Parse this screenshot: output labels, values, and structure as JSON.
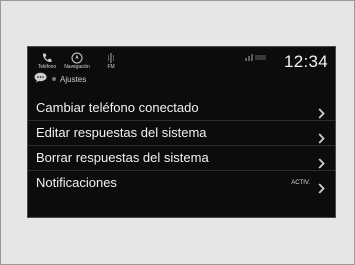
{
  "topbar": {
    "phone_label": "Teléfono",
    "nav_label": "Navegación",
    "fm_label": "FM",
    "clock": "12:34"
  },
  "breadcrumb": {
    "label": "Ajustes"
  },
  "menu": {
    "items": [
      {
        "label": "Cambiar teléfono conectado",
        "status": ""
      },
      {
        "label": "Editar respuestas del sistema",
        "status": ""
      },
      {
        "label": "Borrar respuestas del sistema",
        "status": ""
      },
      {
        "label": "Notificaciones",
        "status": "ACTIV."
      }
    ]
  },
  "icons": {
    "phone": "phone-icon",
    "navigation": "compass-icon",
    "fm": "radio-icon",
    "chat": "chat-bubble-icon",
    "chevron": "chevron-right-icon"
  },
  "colors": {
    "background": "#0c0c0c",
    "text": "#f2f2f2",
    "frame": "#e6e6e6"
  }
}
